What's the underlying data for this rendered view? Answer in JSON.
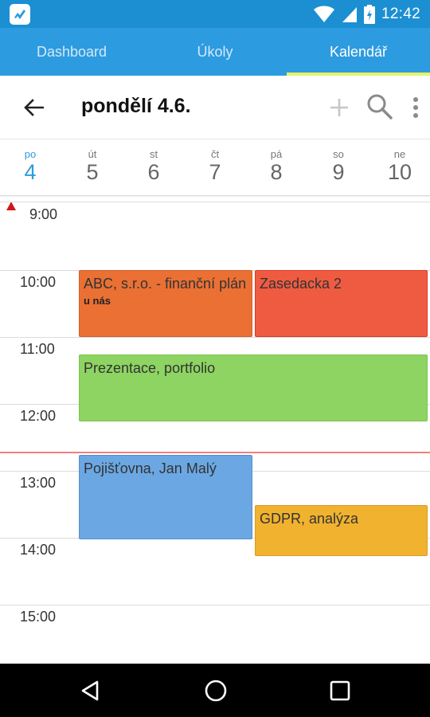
{
  "status_bar": {
    "time": "12:42",
    "icons": [
      "app-icon",
      "wifi-icon",
      "signal-icon",
      "battery-icon"
    ]
  },
  "tabs": [
    {
      "label": "Dashboard",
      "active": false
    },
    {
      "label": "Úkoly",
      "active": false
    },
    {
      "label": "Kalendář",
      "active": true
    }
  ],
  "toolbar": {
    "title": "pondělí 4.6.",
    "icons": [
      "back-arrow-icon",
      "plus-icon",
      "search-icon",
      "more-vert-icon"
    ]
  },
  "days": [
    {
      "name": "po",
      "num": "4",
      "active": true
    },
    {
      "name": "út",
      "num": "5",
      "active": false
    },
    {
      "name": "st",
      "num": "6",
      "active": false
    },
    {
      "name": "čt",
      "num": "7",
      "active": false
    },
    {
      "name": "pá",
      "num": "8",
      "active": false
    },
    {
      "name": "so",
      "num": "9",
      "active": false
    },
    {
      "name": "ne",
      "num": "10",
      "active": false
    }
  ],
  "hours": [
    "9:00",
    "10:00",
    "11:00",
    "12:00",
    "13:00",
    "14:00",
    "15:00"
  ],
  "events": {
    "abc": {
      "title": "ABC, s.r.o. - finanční plán",
      "location": "u nás"
    },
    "zasedacka": {
      "title": "Zasedacka 2"
    },
    "prezentace": {
      "title": "Prezentace, portfolio"
    },
    "pojistovna": {
      "title": "Pojišťovna, Jan Malý"
    },
    "gdpr": {
      "title": "GDPR, analýza"
    }
  },
  "colors": {
    "status_bar": "#1c8fd3",
    "tab_bar": "#2d9be0",
    "tab_indicator": "#e7f26a",
    "event_abc": "#ea7034",
    "event_zasedacka": "#ef5b41",
    "event_prezentace": "#8ed462",
    "event_pojistovna": "#6ba8e3",
    "event_gdpr": "#f0b22f",
    "now_line": "#f07e7e"
  }
}
